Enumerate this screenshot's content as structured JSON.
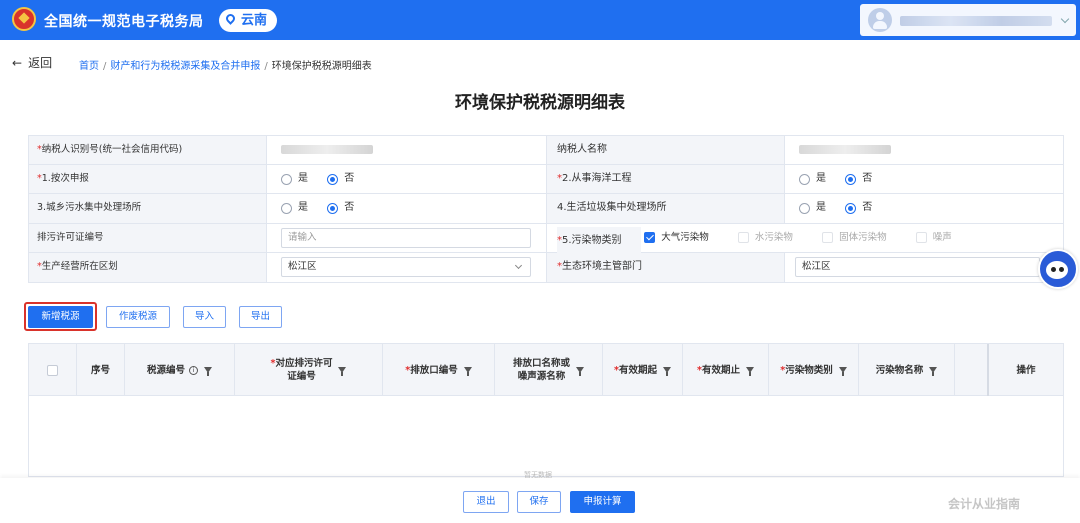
{
  "header": {
    "brand": "全国统一规范电子税务局",
    "region": "云南"
  },
  "breadcrumb": {
    "back": "返回",
    "items": [
      "首页",
      "财产和行为税税源采集及合并申报"
    ],
    "current": "环境保护税税源明细表"
  },
  "page_title": "环境保护税税源明细表",
  "form": {
    "taxpayer_id_label": "纳税人识别号(统一社会信用代码)",
    "taxpayer_name_label": "纳税人名称",
    "per_filing_label": "1.按次申报",
    "marine_label": "2.从事海洋工程",
    "sewage_label": "3.城乡污水集中处理场所",
    "garbage_label": "4.生活垃圾集中处理场所",
    "permit_label": "排污许可证编号",
    "permit_placeholder": "请输入",
    "pollutant_label": "5.污染物类别",
    "pollutants": [
      "大气污染物",
      "水污染物",
      "固体污染物",
      "噪声"
    ],
    "district_label": "生产经营所在区划",
    "district_value": "松江区",
    "eco_dept_label": "生态环境主管部门",
    "eco_dept_value": "松江区",
    "yes": "是",
    "no": "否"
  },
  "actions": {
    "add": "新增税源",
    "void": "作废税源",
    "import": "导入",
    "export": "导出"
  },
  "table": {
    "columns": {
      "seq": "序号",
      "code": "税源编号",
      "permit_a": "对应排污许可",
      "permit_b": "证编号",
      "outlet": "排放口编号",
      "outlet_name_a": "排放口名称或",
      "outlet_name_b": "噪声源名称",
      "valid_from": "有效期起",
      "valid_to": "有效期止",
      "category": "污染物类别",
      "name": "污染物名称",
      "op": "操作"
    },
    "empty": "暂无数据"
  },
  "footer": {
    "exit": "退出",
    "save": "保存",
    "calc": "申报计算"
  },
  "watermark": "会计从业指南",
  "colors": {
    "primary": "#1f6ff0",
    "required": "#e02c2c",
    "highlight": "#d9332b"
  }
}
